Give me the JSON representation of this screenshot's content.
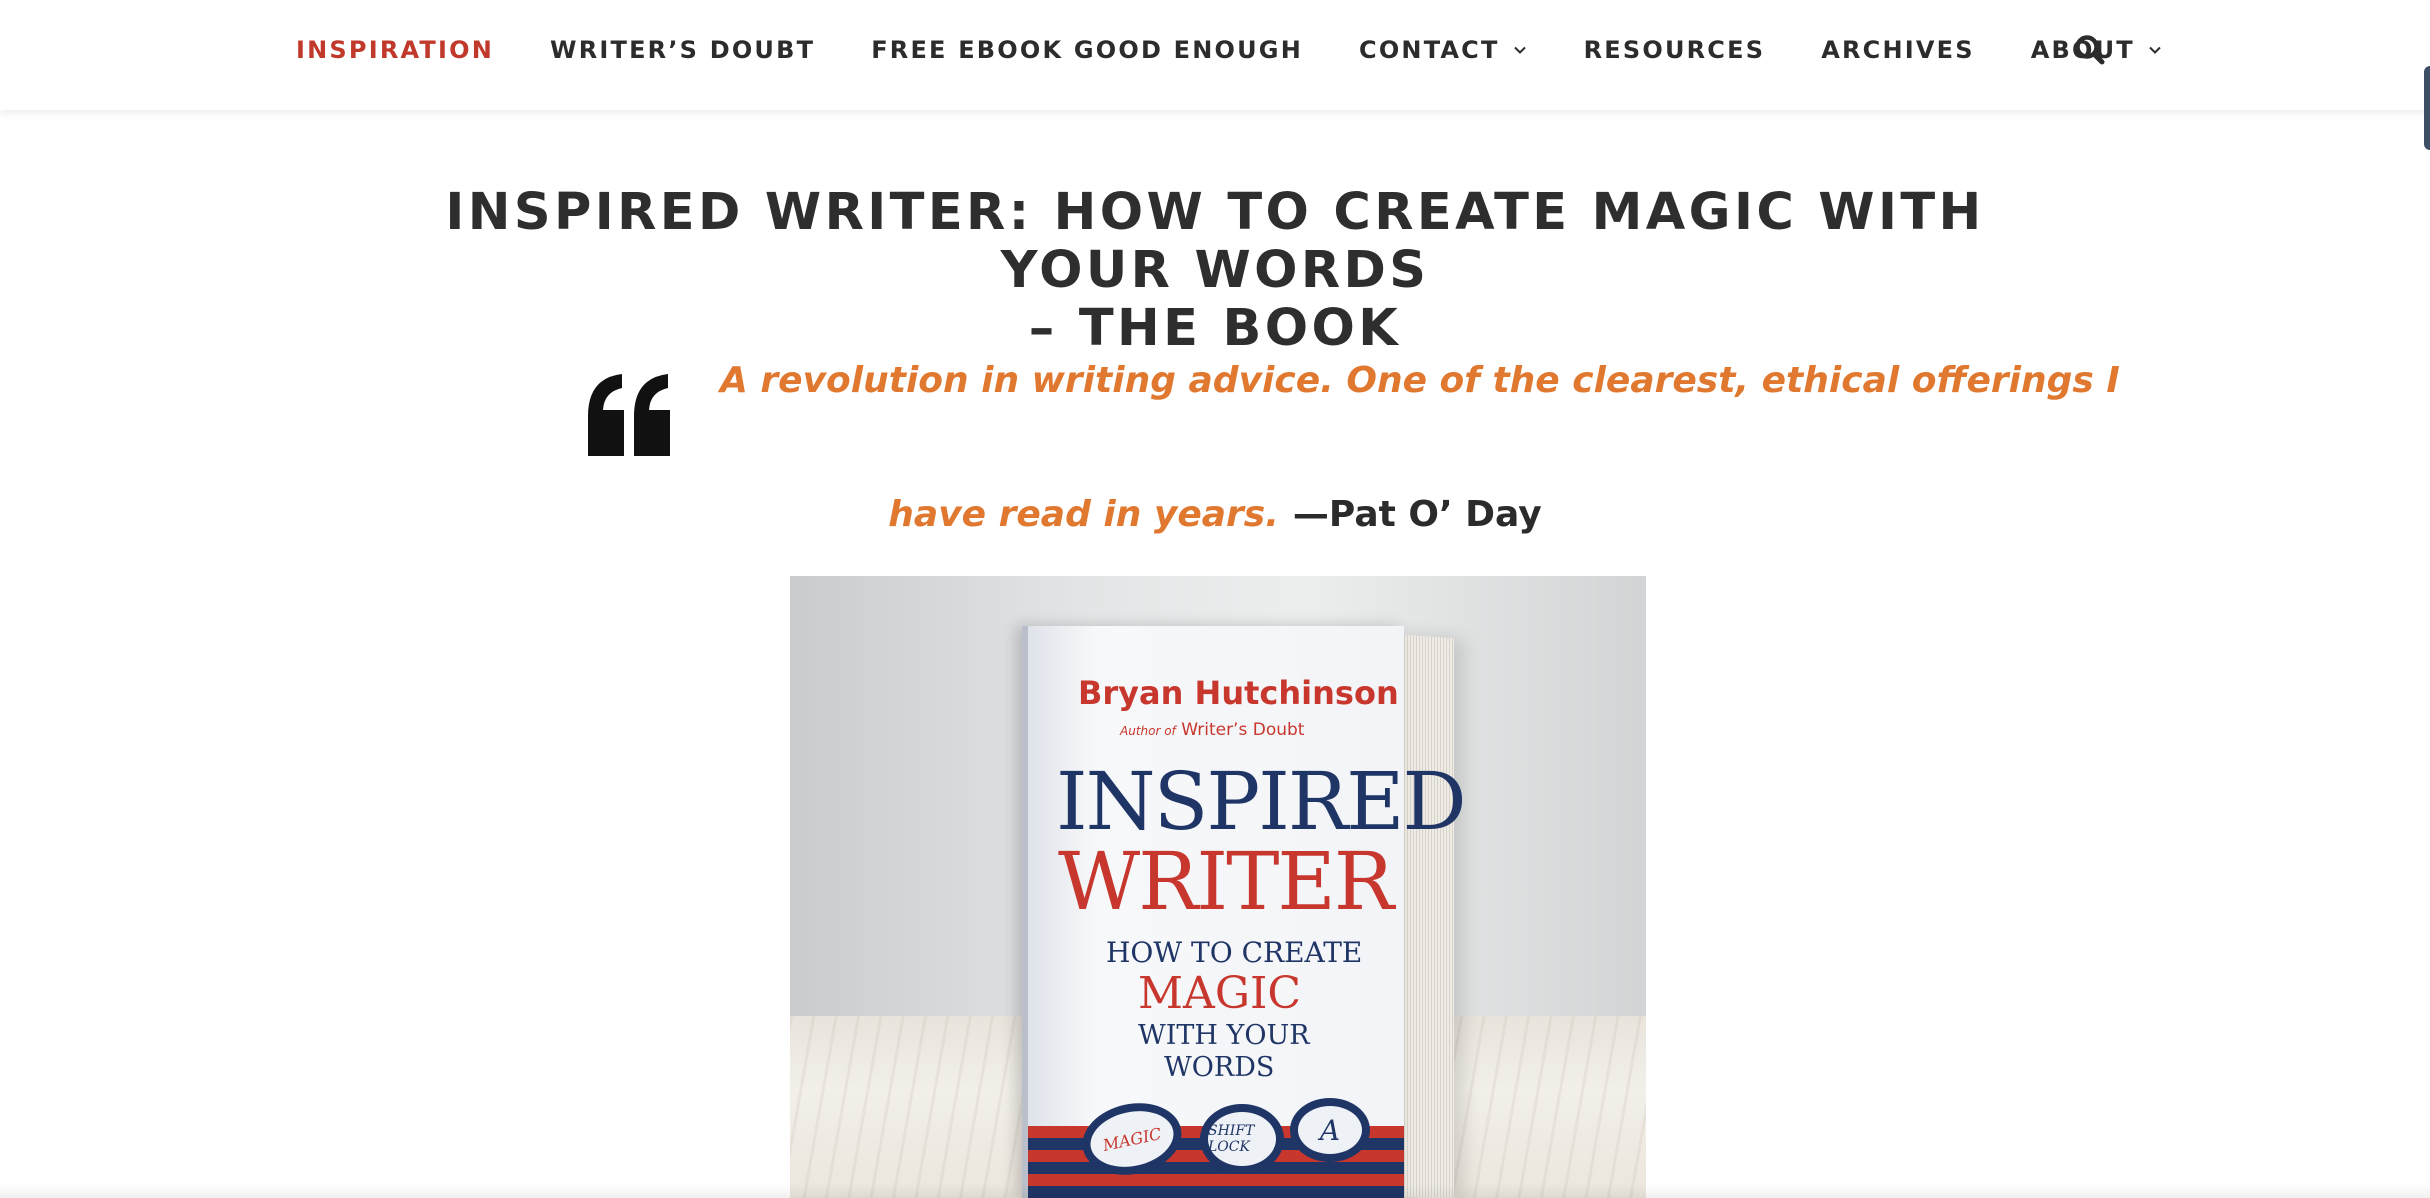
{
  "nav": {
    "items": [
      {
        "label": "INSPIRATION",
        "active": true,
        "has_dropdown": false
      },
      {
        "label": "WRITER’S DOUBT",
        "active": false,
        "has_dropdown": false
      },
      {
        "label": "FREE EBOOK GOOD ENOUGH",
        "active": false,
        "has_dropdown": false
      },
      {
        "label": "CONTACT",
        "active": false,
        "has_dropdown": true
      },
      {
        "label": "RESOURCES",
        "active": false,
        "has_dropdown": false
      },
      {
        "label": "ARCHIVES",
        "active": false,
        "has_dropdown": false
      },
      {
        "label": "ABOUT",
        "active": false,
        "has_dropdown": true
      }
    ],
    "search_icon": "search-icon"
  },
  "article": {
    "title_line1": "INSPIRED WRITER: HOW TO CREATE MAGIC WITH YOUR WORDS",
    "title_line2": "– THE BOOK",
    "quote_line1": "A revolution in writing advice. One of the clearest, ethical offerings I",
    "quote_line2": "have read in years.",
    "quote_cite": "—Pat O’ Day",
    "quote_icon": "quote-open-icon"
  },
  "book_cover": {
    "author": "Bryan Hutchinson",
    "author_of_prefix": "Author of",
    "author_of_title": "Writer’s Doubt",
    "title_word1": "INSPIRED",
    "title_word2": "WRITER",
    "subtitle_1": "HOW TO CREATE",
    "subtitle_2": "MAGIC",
    "subtitle_3": "WITH YOUR",
    "subtitle_4": "WORDS",
    "key_1": "MAGIC",
    "key_2": "SHIFT LOCK",
    "key_3": "A"
  },
  "colors": {
    "active_nav": "#c0392b",
    "quote_orange": "#e0782f",
    "text_dark": "#2b2b2b",
    "cover_red": "#c8372d",
    "cover_navy": "#1f3566"
  }
}
